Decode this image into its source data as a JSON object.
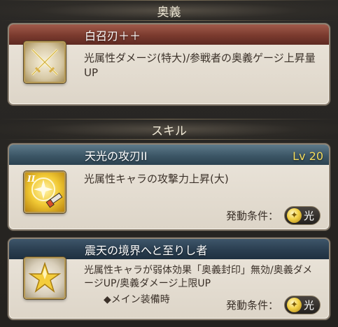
{
  "sections": {
    "ougi_header": "奥義",
    "skill_header": "スキル"
  },
  "ougi": {
    "title": "白召刃＋＋",
    "desc": "光属性ダメージ(特大)/参戦者の奥義ゲージ上昇量UP",
    "icon": "crossed-swords-icon"
  },
  "skills": [
    {
      "title": "天光の攻刃II",
      "level": "Lv 20",
      "desc": "光属性キャラの攻撃力上昇(大)",
      "cond_label": "発動条件：",
      "cond_value": "光",
      "icon": "light-sword-orb-icon"
    },
    {
      "title": "震天の境界へと至りし者",
      "desc": "光属性キャラが弱体効果「奥義封印」無効/奥義ダメージUP/奥義ダメージ上限UP",
      "note": "◆メイン装備時",
      "cond_label": "発動条件：",
      "cond_value": "光",
      "icon": "star-icon"
    }
  ],
  "colors": {
    "accent_gold": "#f4dc5c",
    "title_red": "#7a3a2e",
    "title_blue": "#3c5666"
  }
}
